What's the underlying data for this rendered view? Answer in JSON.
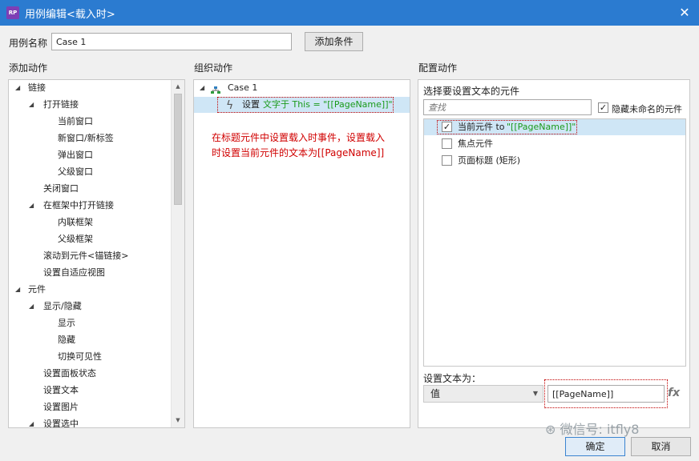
{
  "window": {
    "title": "用例编辑<载入时>",
    "app_icon_text": "RP"
  },
  "case_name": {
    "label": "用例名称",
    "value": "Case 1",
    "add_condition_button": "添加条件"
  },
  "add_actions": {
    "heading": "添加动作",
    "items": [
      {
        "label": "链接",
        "level": 0,
        "expanded": true
      },
      {
        "label": "打开链接",
        "level": 1,
        "expanded": true
      },
      {
        "label": "当前窗口",
        "level": 2
      },
      {
        "label": "新窗口/新标签",
        "level": 2
      },
      {
        "label": "弹出窗口",
        "level": 2
      },
      {
        "label": "父级窗口",
        "level": 2
      },
      {
        "label": "关闭窗口",
        "level": 1
      },
      {
        "label": "在框架中打开链接",
        "level": 1,
        "expanded": true
      },
      {
        "label": "内联框架",
        "level": 2
      },
      {
        "label": "父级框架",
        "level": 2
      },
      {
        "label": "滚动到元件<锚链接>",
        "level": 1
      },
      {
        "label": "设置自适应视图",
        "level": 1
      },
      {
        "label": "元件",
        "level": 0,
        "expanded": true
      },
      {
        "label": "显示/隐藏",
        "level": 1,
        "expanded": true
      },
      {
        "label": "显示",
        "level": 2
      },
      {
        "label": "隐藏",
        "level": 2
      },
      {
        "label": "切换可见性",
        "level": 2
      },
      {
        "label": "设置面板状态",
        "level": 1
      },
      {
        "label": "设置文本",
        "level": 1
      },
      {
        "label": "设置图片",
        "level": 1
      },
      {
        "label": "设置选中",
        "level": 1,
        "expanded": true
      }
    ]
  },
  "organize_actions": {
    "heading": "组织动作",
    "case_label": "Case 1",
    "action_prefix": "设置",
    "action_detail": "文字于 This = \"[[PageName]]\"",
    "annotation_line1": "在标题元件中设置载入时事件，设置载入",
    "annotation_line2": "时设置当前元件的文本为[[PageName]]"
  },
  "configure_actions": {
    "heading": "配置动作",
    "subheading": "选择要设置文本的元件",
    "search_placeholder": "查找",
    "hide_unnamed_label": "隐藏未命名的元件",
    "hide_unnamed_checked": true,
    "widgets": [
      {
        "label_prefix": "当前元件 to",
        "label_value": "\"[[PageName]]\"",
        "checked": true,
        "selected": true
      },
      {
        "label_prefix": "焦点元件",
        "label_value": "",
        "checked": false,
        "selected": false
      },
      {
        "label_prefix": "页面标题 (矩形)",
        "label_value": "",
        "checked": false,
        "selected": false
      }
    ],
    "set_text_label": "设置文本为：",
    "set_text_type": "值",
    "set_text_value": "[[PageName]]",
    "fx_label": "fx"
  },
  "watermark": "微信号: itfly8",
  "footer": {
    "ok_label": "确定",
    "cancel_label": "取消"
  },
  "colors": {
    "title_bar": "#2b7bd0",
    "annotation": "#d00000",
    "value_green": "#1a9a1a",
    "selection": "#cfe6f6"
  }
}
